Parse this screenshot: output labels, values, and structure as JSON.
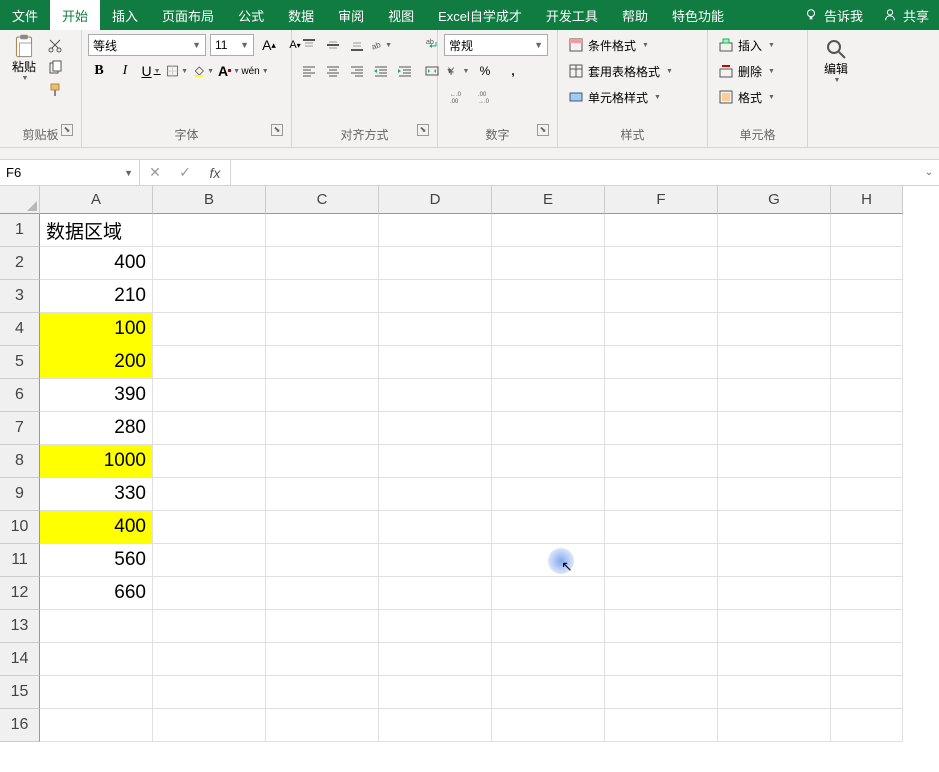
{
  "menu": {
    "items": [
      "文件",
      "开始",
      "插入",
      "页面布局",
      "公式",
      "数据",
      "审阅",
      "视图",
      "Excel自学成才",
      "开发工具",
      "帮助",
      "特色功能"
    ],
    "active_index": 1,
    "tell_me": "告诉我",
    "share": "共享"
  },
  "ribbon": {
    "clipboard": {
      "paste": "粘贴",
      "label": "剪贴板"
    },
    "font": {
      "name": "等线",
      "size": "11",
      "bold": "B",
      "italic": "I",
      "underline": "U",
      "grow": "A",
      "shrink": "A",
      "border": "⊞",
      "fill": "◆",
      "fontcolor": "A",
      "phonetic": "wén",
      "label": "字体"
    },
    "alignment": {
      "wrap": "ab",
      "merge": "⊞",
      "label": "对齐方式"
    },
    "number": {
      "format": "常规",
      "currency": "¥",
      "percent": "%",
      "comma": ",",
      "inc": "←.0",
      "dec": ".00→",
      "label": "数字"
    },
    "styles": {
      "conditional": "条件格式",
      "table": "套用表格格式",
      "cell": "单元格样式",
      "label": "样式"
    },
    "cells": {
      "insert": "插入",
      "delete": "删除",
      "format": "格式",
      "label": "单元格"
    },
    "editing": {
      "label": "编辑"
    }
  },
  "namebox": {
    "ref": "F6"
  },
  "formula": {
    "value": ""
  },
  "grid": {
    "columns": [
      "A",
      "B",
      "C",
      "D",
      "E",
      "F",
      "G",
      "H"
    ],
    "rows": [
      {
        "n": 1,
        "cells": [
          "数据区域",
          "",
          "",
          "",
          "",
          "",
          "",
          ""
        ],
        "yellow": [],
        "types": [
          "text"
        ]
      },
      {
        "n": 2,
        "cells": [
          "400",
          "",
          "",
          "",
          "",
          "",
          "",
          ""
        ],
        "yellow": [],
        "types": [
          "num"
        ]
      },
      {
        "n": 3,
        "cells": [
          "210",
          "",
          "",
          "",
          "",
          "",
          "",
          ""
        ],
        "yellow": [],
        "types": [
          "num"
        ]
      },
      {
        "n": 4,
        "cells": [
          "100",
          "",
          "",
          "",
          "",
          "",
          "",
          ""
        ],
        "yellow": [
          0
        ],
        "types": [
          "num"
        ]
      },
      {
        "n": 5,
        "cells": [
          "200",
          "",
          "",
          "",
          "",
          "",
          "",
          ""
        ],
        "yellow": [
          0
        ],
        "types": [
          "num"
        ]
      },
      {
        "n": 6,
        "cells": [
          "390",
          "",
          "",
          "",
          "",
          "",
          "",
          ""
        ],
        "yellow": [],
        "types": [
          "num"
        ]
      },
      {
        "n": 7,
        "cells": [
          "280",
          "",
          "",
          "",
          "",
          "",
          "",
          ""
        ],
        "yellow": [],
        "types": [
          "num"
        ]
      },
      {
        "n": 8,
        "cells": [
          "1000",
          "",
          "",
          "",
          "",
          "",
          "",
          ""
        ],
        "yellow": [
          0
        ],
        "types": [
          "num"
        ]
      },
      {
        "n": 9,
        "cells": [
          "330",
          "",
          "",
          "",
          "",
          "",
          "",
          ""
        ],
        "yellow": [],
        "types": [
          "num"
        ]
      },
      {
        "n": 10,
        "cells": [
          "400",
          "",
          "",
          "",
          "",
          "",
          "",
          ""
        ],
        "yellow": [
          0
        ],
        "types": [
          "num"
        ]
      },
      {
        "n": 11,
        "cells": [
          "560",
          "",
          "",
          "",
          "",
          "",
          "",
          ""
        ],
        "yellow": [],
        "types": [
          "num"
        ]
      },
      {
        "n": 12,
        "cells": [
          "660",
          "",
          "",
          "",
          "",
          "",
          "",
          ""
        ],
        "yellow": [],
        "types": [
          "num"
        ]
      },
      {
        "n": 13,
        "cells": [
          "",
          "",
          "",
          "",
          "",
          "",
          "",
          ""
        ],
        "yellow": [],
        "types": []
      },
      {
        "n": 14,
        "cells": [
          "",
          "",
          "",
          "",
          "",
          "",
          "",
          ""
        ],
        "yellow": [],
        "types": []
      },
      {
        "n": 15,
        "cells": [
          "",
          "",
          "",
          "",
          "",
          "",
          "",
          ""
        ],
        "yellow": [],
        "types": []
      },
      {
        "n": 16,
        "cells": [
          "",
          "",
          "",
          "",
          "",
          "",
          "",
          ""
        ],
        "yellow": [],
        "types": []
      }
    ]
  }
}
